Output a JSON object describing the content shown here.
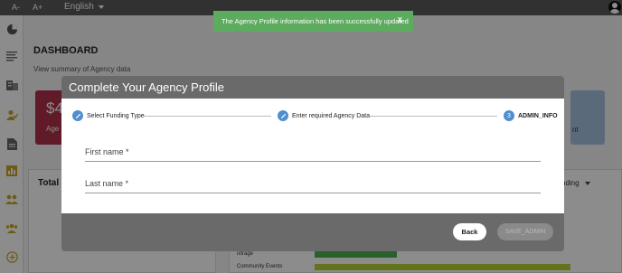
{
  "topbar": {
    "font_decrease": "A-",
    "font_increase": "A+",
    "language": "English"
  },
  "toast": {
    "message": "The Agency Profile information has been successfully updated",
    "close": "X",
    "color": "#5cab5f"
  },
  "dashboard": {
    "title": "DASHBOARD",
    "subtitle": "View summary of Agency data",
    "card_red": {
      "value": "$4",
      "label": "Age",
      "color": "#b03049"
    },
    "card_blue": {
      "label": "nt",
      "color": "#a7c1e0"
    },
    "panel_left_title": "Total E",
    "panel_right_select": "nding",
    "bars": [
      {
        "label": "ixtrage",
        "value": 0.28
      },
      {
        "label": "Community Events",
        "value": 0.87
      }
    ]
  },
  "modal": {
    "title": "Complete Your Agency Profile",
    "steps": [
      {
        "label": "Select Funding Type",
        "marker": ""
      },
      {
        "label": "Enter required Agency Data",
        "marker": ""
      },
      {
        "label": "ADMIN_INFO",
        "marker": "3"
      }
    ],
    "fields": [
      {
        "label": "First name *"
      },
      {
        "label": "Last name *"
      }
    ],
    "back_label": "Back",
    "save_label": "SAVE_ADMIN"
  },
  "sidebar": {
    "icons": [
      "dashboard-icon",
      "list-icon",
      "building-icon",
      "user-check-icon",
      "document-icon",
      "bar-chart-icon",
      "users-icon",
      "group-icon",
      "add-circle-icon"
    ]
  }
}
